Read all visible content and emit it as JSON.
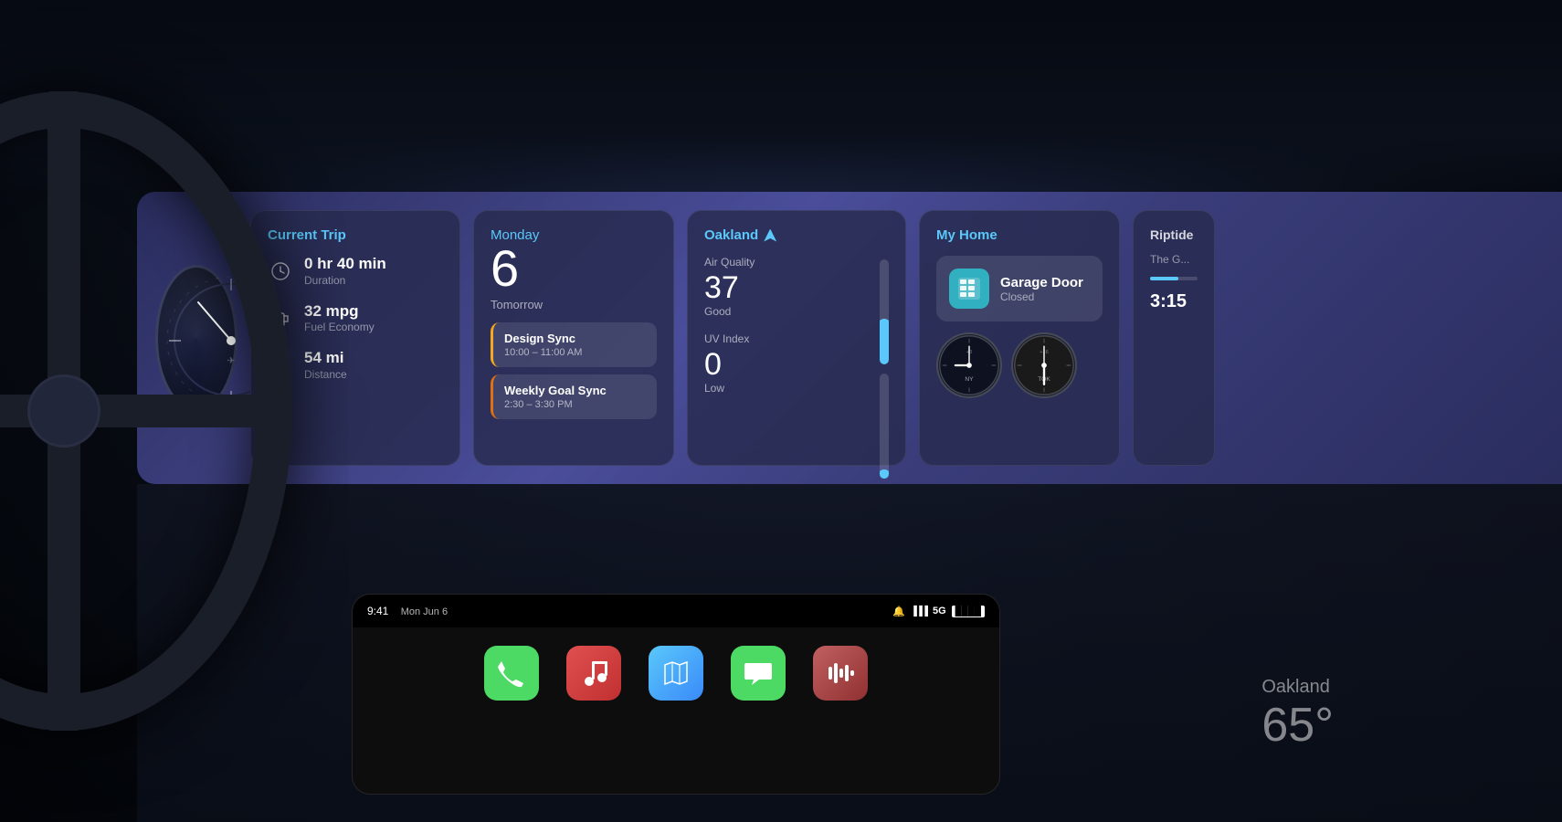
{
  "background": {
    "color_top": "#1a2340",
    "color_bottom": "#020408"
  },
  "dashboard": {
    "trip_card": {
      "title": "Current Trip",
      "duration_value": "0 hr 40 min",
      "duration_label": "Duration",
      "fuel_value": "32 mpg",
      "fuel_label": "Fuel Economy",
      "distance_value": "54 mi",
      "distance_label": "Distance"
    },
    "calendar_card": {
      "title": "Monday",
      "date_number": "6",
      "tomorrow_label": "Tomorrow",
      "events": [
        {
          "name": "Design Sync",
          "time": "10:00 – 11:00 AM",
          "color": "yellow"
        },
        {
          "name": "Weekly Goal Sync",
          "time": "2:30 – 3:30 PM",
          "color": "orange"
        }
      ]
    },
    "weather_card": {
      "title": "Oakland",
      "air_quality_label": "Air Quality",
      "air_quality_value": "37",
      "air_quality_status": "Good",
      "air_quality_bar_percent": 37,
      "uv_index_label": "UV Index",
      "uv_index_value": "0",
      "uv_index_status": "Low",
      "uv_index_bar_percent": 2
    },
    "home_card": {
      "title": "My Home",
      "garage_door_title": "Garage Door",
      "garage_door_status": "Closed",
      "clock1_label": "NY",
      "clock1_offset": "+3",
      "clock2_label": "TOK",
      "clock2_offset": "+16"
    },
    "riptide_card": {
      "title": "Riptide",
      "subtitle": "The G...",
      "time": "3:15"
    }
  },
  "phone": {
    "status_time": "9:41",
    "status_date": "Mon Jun 6",
    "signal_bars": "●●●",
    "network": "5G",
    "battery": "████",
    "apps": [
      {
        "name": "Phone",
        "color": "#4cd964",
        "icon": "📞"
      },
      {
        "name": "Music",
        "color": "#e05050",
        "icon": "🎵"
      },
      {
        "name": "Maps",
        "color": "#5ac8fa",
        "icon": "🗺️"
      },
      {
        "name": "Messages",
        "color": "#4cd964",
        "icon": "💬"
      },
      {
        "name": "Music Player",
        "color": "#e07070",
        "icon": "🎶"
      }
    ]
  },
  "bottom_weather": {
    "city": "Oakland",
    "temp": "65°"
  }
}
